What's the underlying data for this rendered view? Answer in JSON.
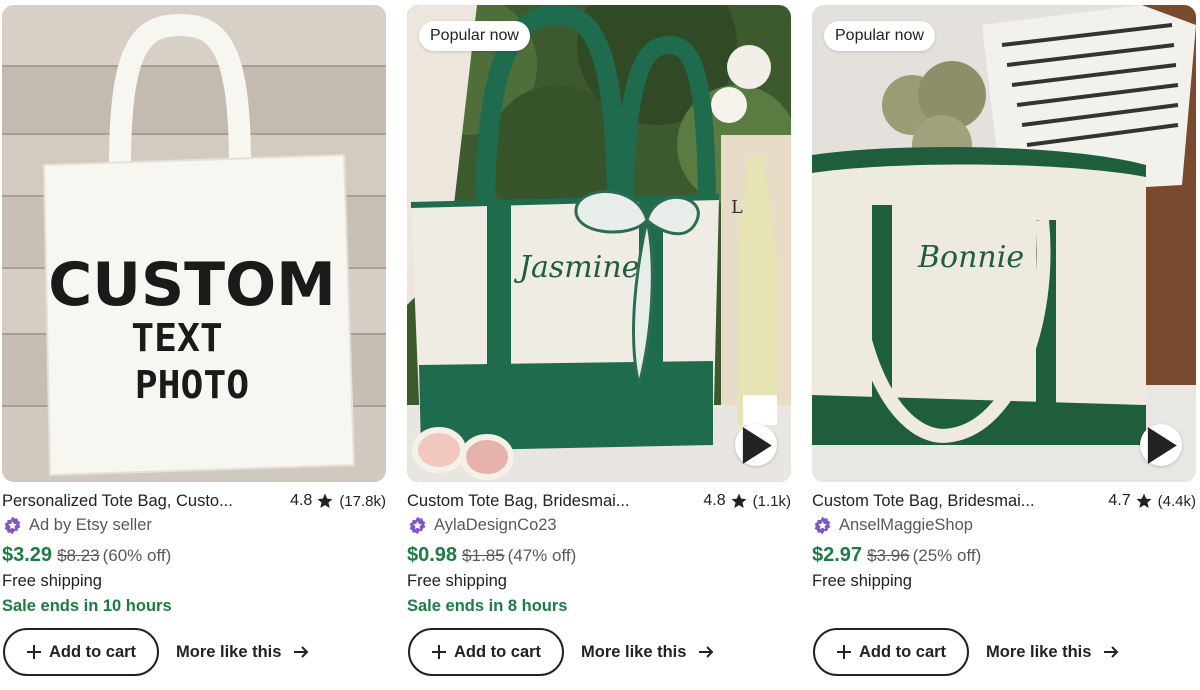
{
  "listings": [
    {
      "badge": "",
      "title": "Personalized Tote Bag, Custo...",
      "rating": "4.8",
      "review_count": "(17.8k)",
      "seller": "Ad by Etsy seller",
      "price": "$3.29",
      "original_price": "$8.23",
      "discount": "(60% off)",
      "shipping": "Free shipping",
      "sale_note": "Sale ends in 10 hours",
      "add_to_cart": "Add to cart",
      "more_like_this": "More like this",
      "image_text": [
        "CUSTOM",
        "TEXT",
        "PHOTO"
      ]
    },
    {
      "badge": "Popular now",
      "title": "Custom Tote Bag, Bridesmai...",
      "rating": "4.8",
      "review_count": "(1.1k)",
      "seller": "AylaDesignCo23",
      "price": "$0.98",
      "original_price": "$1.85",
      "discount": "(47% off)",
      "shipping": "Free shipping",
      "sale_note": "Sale ends in 8 hours",
      "add_to_cart": "Add to cart",
      "more_like_this": "More like this",
      "image_text": [
        "Jasmine"
      ]
    },
    {
      "badge": "Popular now",
      "title": "Custom Tote Bag, Bridesmai...",
      "rating": "4.7",
      "review_count": "(4.4k)",
      "seller": "AnselMaggieShop",
      "price": "$2.97",
      "original_price": "$3.96",
      "discount": "(25% off)",
      "shipping": "Free shipping",
      "sale_note": "",
      "add_to_cart": "Add to cart",
      "more_like_this": "More like this",
      "image_text": [
        "Bonnie"
      ]
    }
  ],
  "icons": {
    "rating": "star-icon",
    "seller": "star-seller-badge-icon",
    "video": "play-icon",
    "cart": "plus-icon",
    "more": "arrow-right-icon"
  },
  "colors": {
    "sale_price": "#1c7c44",
    "seller_badge": "#7f56c8",
    "text": "#222222",
    "muted": "#595959"
  }
}
